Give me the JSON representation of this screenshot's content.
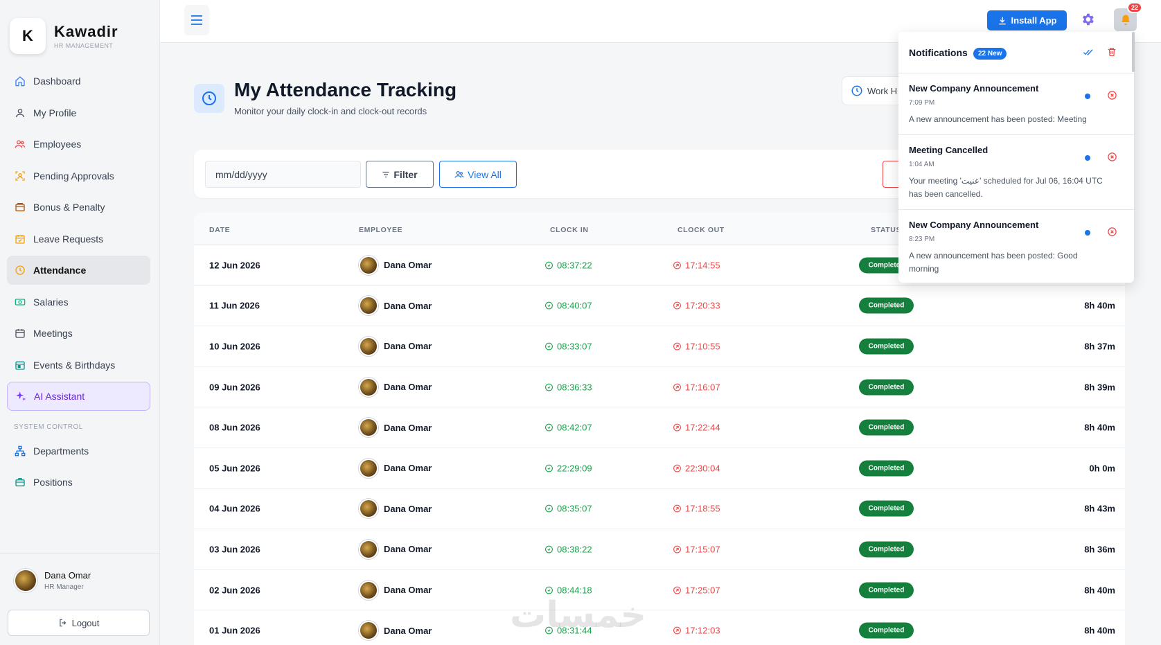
{
  "brand": {
    "initial": "K",
    "name": "Kawadir",
    "subtitle": "HR MANAGEMENT"
  },
  "sidebar": {
    "items": [
      {
        "label": "Dashboard",
        "icon": "home-icon"
      },
      {
        "label": "My Profile",
        "icon": "user-icon"
      },
      {
        "label": "Employees",
        "icon": "users-icon"
      },
      {
        "label": "Pending Approvals",
        "icon": "approval-icon"
      },
      {
        "label": "Bonus & Penalty",
        "icon": "wallet-icon"
      },
      {
        "label": "Leave Requests",
        "icon": "calendar-check-icon"
      },
      {
        "label": "Attendance",
        "icon": "clock-icon",
        "active": true
      },
      {
        "label": "Salaries",
        "icon": "cash-icon"
      },
      {
        "label": "Meetings",
        "icon": "calendar-icon"
      },
      {
        "label": "Events & Birthdays",
        "icon": "event-icon"
      },
      {
        "label": "AI Assistant",
        "icon": "sparkle-icon"
      }
    ],
    "section_label": "SYSTEM CONTROL",
    "system_items": [
      {
        "label": "Departments",
        "icon": "org-chart-icon"
      },
      {
        "label": "Positions",
        "icon": "briefcase-icon"
      }
    ],
    "user": {
      "name": "Dana Omar",
      "role": "HR Manager"
    },
    "logout_label": "Logout"
  },
  "topbar": {
    "install_label": "Install App",
    "notification_count": "22"
  },
  "header": {
    "title": "My Attendance Tracking",
    "subtitle": "Monitor your daily clock-in and clock-out records",
    "work_chip": "Work H"
  },
  "filters": {
    "date_placeholder": "mm/dd/yyyy",
    "filter_label": "Filter",
    "view_all_label": "View All"
  },
  "table": {
    "columns": [
      "DATE",
      "EMPLOYEE",
      "CLOCK IN",
      "CLOCK OUT",
      "STATUS"
    ],
    "rows": [
      {
        "date": "12 Jun 2026",
        "employee": "Dana Omar",
        "clock_in": "08:37:22",
        "clock_out": "17:14:55",
        "status": "Completed",
        "hours": ""
      },
      {
        "date": "11 Jun 2026",
        "employee": "Dana Omar",
        "clock_in": "08:40:07",
        "clock_out": "17:20:33",
        "status": "Completed",
        "hours": "8h 40m"
      },
      {
        "date": "10 Jun 2026",
        "employee": "Dana Omar",
        "clock_in": "08:33:07",
        "clock_out": "17:10:55",
        "status": "Completed",
        "hours": "8h 37m"
      },
      {
        "date": "09 Jun 2026",
        "employee": "Dana Omar",
        "clock_in": "08:36:33",
        "clock_out": "17:16:07",
        "status": "Completed",
        "hours": "8h 39m"
      },
      {
        "date": "08 Jun 2026",
        "employee": "Dana Omar",
        "clock_in": "08:42:07",
        "clock_out": "17:22:44",
        "status": "Completed",
        "hours": "8h 40m"
      },
      {
        "date": "05 Jun 2026",
        "employee": "Dana Omar",
        "clock_in": "22:29:09",
        "clock_out": "22:30:04",
        "status": "Completed",
        "hours": "0h 0m"
      },
      {
        "date": "04 Jun 2026",
        "employee": "Dana Omar",
        "clock_in": "08:35:07",
        "clock_out": "17:18:55",
        "status": "Completed",
        "hours": "8h 43m"
      },
      {
        "date": "03 Jun 2026",
        "employee": "Dana Omar",
        "clock_in": "08:38:22",
        "clock_out": "17:15:07",
        "status": "Completed",
        "hours": "8h 36m"
      },
      {
        "date": "02 Jun 2026",
        "employee": "Dana Omar",
        "clock_in": "08:44:18",
        "clock_out": "17:25:07",
        "status": "Completed",
        "hours": "8h 40m"
      },
      {
        "date": "01 Jun 2026",
        "employee": "Dana Omar",
        "clock_in": "08:31:44",
        "clock_out": "17:12:03",
        "status": "Completed",
        "hours": "8h 40m"
      }
    ]
  },
  "notifications": {
    "title": "Notifications",
    "badge": "22 New",
    "items": [
      {
        "title": "New Company Announcement",
        "time": "7:09 PM",
        "message": "A new announcement has been posted: Meeting"
      },
      {
        "title": "Meeting Cancelled",
        "time": "1:04 AM",
        "message": "Your meeting 'عنيت' scheduled for Jul 06, 16:04 UTC has been cancelled."
      },
      {
        "title": "New Company Announcement",
        "time": "8:23 PM",
        "message": "A new announcement has been posted: Good morning"
      }
    ]
  },
  "watermark": "خمسات",
  "colors": {
    "accent": "#1a73e8",
    "success": "#15803d",
    "danger": "#ef4444",
    "clock_in": "#16a34a"
  }
}
